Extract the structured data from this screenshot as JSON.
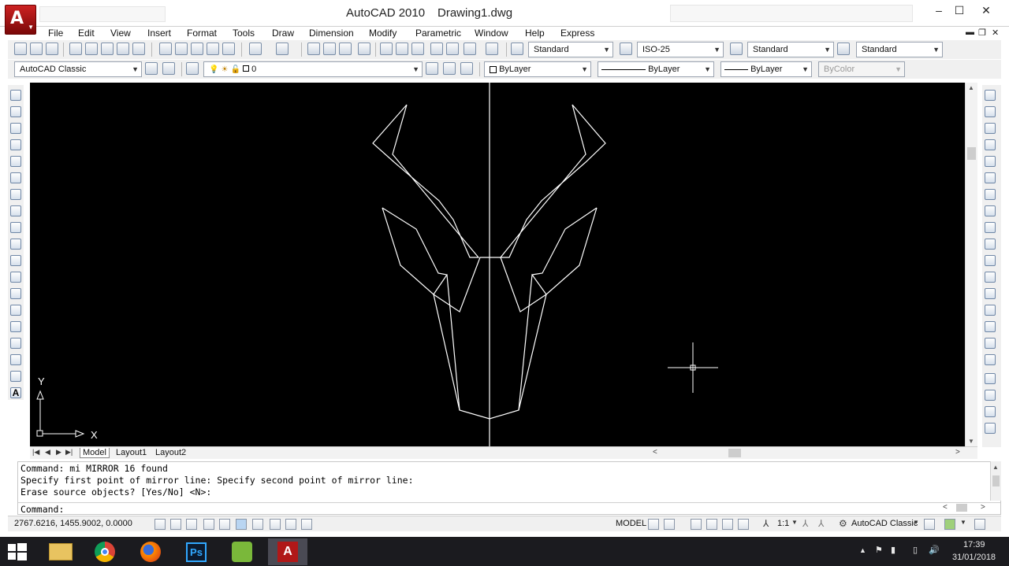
{
  "titlebar": {
    "app_name": "AutoCAD 2010",
    "document": "Drawing1.dwg",
    "controls": {
      "minimize": "–",
      "maximize": "☐",
      "close": "✕"
    }
  },
  "menu": [
    "File",
    "Edit",
    "View",
    "Insert",
    "Format",
    "Tools",
    "Draw",
    "Dimension",
    "Modify",
    "Parametric",
    "Window",
    "Help",
    "Express"
  ],
  "styles": {
    "text_style": "Standard",
    "dim_style": "ISO-25",
    "table_style": "Standard",
    "multileader_style": "Standard"
  },
  "workspace": "AutoCAD Classic",
  "layer": "0",
  "properties": {
    "color": "ByLayer",
    "linetype": "ByLayer",
    "lineweight": "ByLayer",
    "plotstyle": "ByColor"
  },
  "ucs": {
    "x_label": "X",
    "y_label": "Y"
  },
  "layout_tabs": [
    "Model",
    "Layout1",
    "Layout2"
  ],
  "command_history": [
    "Command: mi MIRROR 16 found",
    "Specify first point of mirror line: Specify second point of mirror line:",
    "Erase source objects? [Yes/No] <N>:"
  ],
  "command_prompt": "Command:",
  "status": {
    "coordinates": "2767.6216, 1455.9002, 0.0000",
    "space": "MODEL",
    "annotation_scale": "1:1",
    "workspace": "AutoCAD Classic"
  },
  "taskbar": {
    "time": "17:39",
    "date": "31/01/2018"
  },
  "colors": {
    "canvas": "#000000",
    "geometry": "#ffffff",
    "taskbar": "#1b1b1f",
    "app_button": "#b01818"
  }
}
